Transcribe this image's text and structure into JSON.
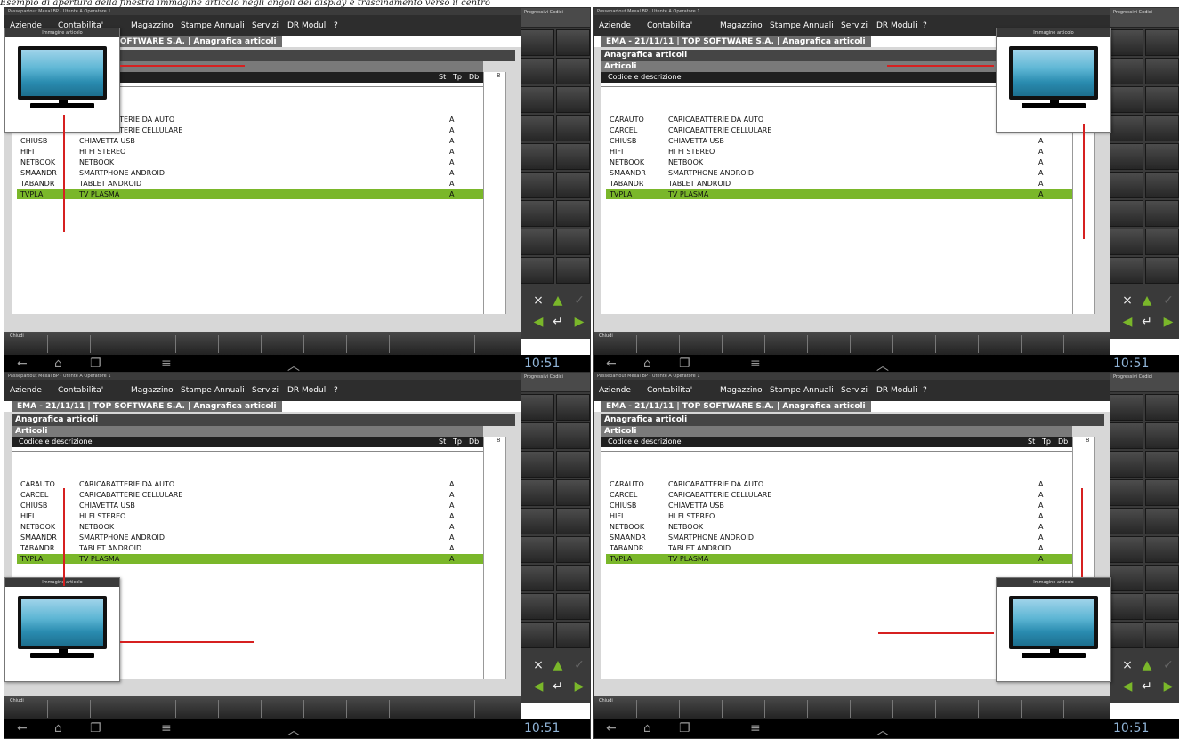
{
  "caption": "Esempio di apertura della finestra immagine articolo negli angoli del display e trascinamento verso il centro",
  "window_title": "Passepartout Mexal BP - Utente A Operatore 1",
  "menu": [
    "Aziende",
    "Contabilita'",
    "Magazzino",
    "Stampe",
    "Annuali",
    "Servizi",
    "DR",
    "Moduli",
    "?"
  ],
  "app_info": "EMA - 21/11/11 | TOP SOFTWARE S.A. | Anagrafica articoli",
  "page_title": "Anagrafica articoli",
  "subtitle": "Articoli",
  "list_header": {
    "code_desc": "Codice e descrizione",
    "st": "St",
    "tp": "Tp",
    "db": "Db"
  },
  "scroll_number": "8",
  "rows": [
    {
      "code": "CARAUTO",
      "desc": "CARICABATTERIE DA AUTO",
      "st": "A"
    },
    {
      "code": "CARCEL",
      "desc": "CARICABATTERIE CELLULARE",
      "st": "A"
    },
    {
      "code": "CHIUSB",
      "desc": "CHIAVETTA USB",
      "st": "A"
    },
    {
      "code": "HIFI",
      "desc": "HI FI STEREO",
      "st": "A"
    },
    {
      "code": "NETBOOK",
      "desc": "NETBOOK",
      "st": "A"
    },
    {
      "code": "SMAANDR",
      "desc": "SMARTPHONE ANDROID",
      "st": "A"
    },
    {
      "code": "TABANDR",
      "desc": "TABLET ANDROID",
      "st": "A"
    },
    {
      "code": "TVPLA",
      "desc": "TV PLASMA",
      "st": "A"
    }
  ],
  "right_panel_top": "Progressivi Codici",
  "bottom_label": "Chiudi",
  "popup_title": "Immagine articolo",
  "clock": "10:51",
  "colors": {
    "selection": "#7ab72a",
    "arrow": "#d62020",
    "dark": "#2d2d2d"
  }
}
